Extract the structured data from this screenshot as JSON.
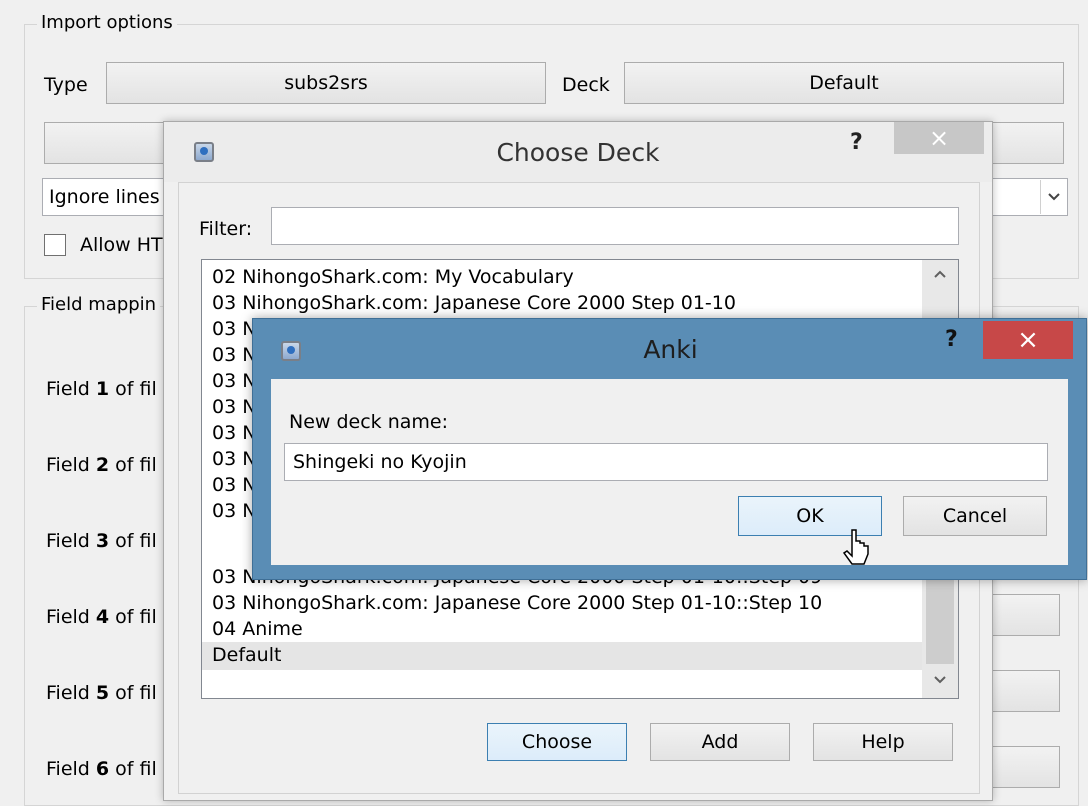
{
  "import_options": {
    "group_title": "Import options",
    "type_label": "Type",
    "type_value": "subs2srs",
    "deck_label": "Deck",
    "deck_value": "Default",
    "ignore_lines_text": "Ignore lines",
    "allow_html_text": "Allow HT"
  },
  "field_mapping": {
    "group_title": "Field mappin",
    "rows": [
      {
        "pre": "Field ",
        "num": "1",
        "post": " of fil"
      },
      {
        "pre": "Field ",
        "num": "2",
        "post": " of fil"
      },
      {
        "pre": "Field ",
        "num": "3",
        "post": " of fil"
      },
      {
        "pre": "Field ",
        "num": "4",
        "post": " of fil"
      },
      {
        "pre": "Field ",
        "num": "5",
        "post": " of fil"
      },
      {
        "pre": "Field ",
        "num": "6",
        "post": " of fil"
      }
    ]
  },
  "choose_deck": {
    "title": "Choose Deck",
    "help_glyph": "?",
    "close_glyph": "×",
    "filter_label": "Filter:",
    "filter_value": "",
    "items": [
      "02 NihongoShark.com: My Vocabulary",
      "03 NihongoShark.com: Japanese Core 2000 Step 01-10",
      "03 N",
      "03 N",
      "03 N",
      "03 N",
      "03 N",
      "03 N",
      "03 N",
      "03 N",
      "03 NihongoShark.com: Japanese Core 2000 Step 01-10::Step 09",
      "03 NihongoShark.com: Japanese Core 2000 Step 01-10::Step 10",
      "04 Anime",
      "Default"
    ],
    "selected_index": 13,
    "choose_label": "Choose",
    "add_label": "Add",
    "help_label": "Help"
  },
  "anki_dialog": {
    "title": "Anki",
    "help_glyph": "?",
    "close_glyph": "×",
    "prompt": "New deck name:",
    "input_value": "Shingeki no Kyojin",
    "ok_label": "OK",
    "cancel_label": "Cancel"
  },
  "colors": {
    "anki_frame": "#5a8db5",
    "close_red": "#c74848",
    "focus_blue": "#3c7fb1",
    "selection": "#e5e5e5"
  }
}
